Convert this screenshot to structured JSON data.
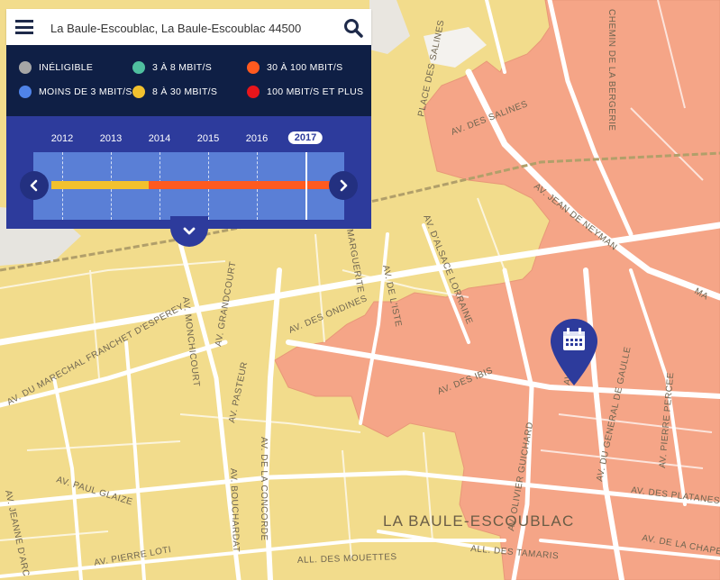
{
  "search": {
    "value": "La Baule-Escoublac, La Baule-Escoublac 44500",
    "menu_icon": "hamburger-menu-icon",
    "search_icon": "magnifier-icon"
  },
  "legend": {
    "items": [
      {
        "label": "INÉLIGIBLE",
        "color": "#a6a6a6"
      },
      {
        "label": "3 À 8 MBIT/S",
        "color": "#4fbf9f"
      },
      {
        "label": "30 À 100 MBIT/S",
        "color": "#ff5a1f"
      },
      {
        "label": "MOINS DE 3 MBIT/S",
        "color": "#4f83e8"
      },
      {
        "label": "8 À 30 MBIT/S",
        "color": "#f2c12e"
      },
      {
        "label": "100 MBIT/S ET PLUS",
        "color": "#e8151b"
      }
    ]
  },
  "timeline": {
    "years": [
      "2012",
      "2013",
      "2014",
      "2015",
      "2016",
      "2017"
    ],
    "selected_year": "2017",
    "segments": [
      {
        "from": "2012",
        "to": "2014",
        "color": "#f2c12e"
      },
      {
        "from": "2014",
        "to": "2017",
        "color": "#ff5a1f"
      }
    ],
    "prev_icon": "chevron-left-icon",
    "next_icon": "chevron-right-icon",
    "collapse_icon": "chevron-down-icon"
  },
  "map": {
    "city_label": "LA BAULE-ESCOUBLAC",
    "marker_icon": "calendar-icon",
    "colors": {
      "base": "#f2dc8c",
      "zone_high": "#f5a587",
      "road": "#ffffff"
    },
    "streets": [
      "AV. DES SALINES",
      "CHEMIN DE LA BERGERIE",
      "PLACE DES SALINES",
      "AV. JEAN DE NEYMAN",
      "AV. D'ALSACE LORRAINE",
      "AV. DE L'ISTE",
      "MARGUERITE",
      "AV. DES ONDINES",
      "AV. GRANDCOURT",
      "AV. MONCHICOURT",
      "AV. DU MARECHAL FRANCHET D'ESPEREY",
      "AV. PASTEUR",
      "AV. DES IBIS",
      "AV. OLIVIER GUICHARD",
      "AV. DU GENERAL DE GAULLE",
      "AV. PIERRE PERCEE",
      "AV. DES PLATANES",
      "AV. PAUL GLAIZE",
      "AV. DE LA CONCORDE",
      "AV. BOUCHARDAT",
      "AV. JEANNE D'ARC",
      "AV. PIERRE LOTI",
      "ALL. DES MOUETTES",
      "ALL. DES TAMARIS",
      "AV. DE LA CHAPE",
      "AV.",
      "MA"
    ]
  }
}
